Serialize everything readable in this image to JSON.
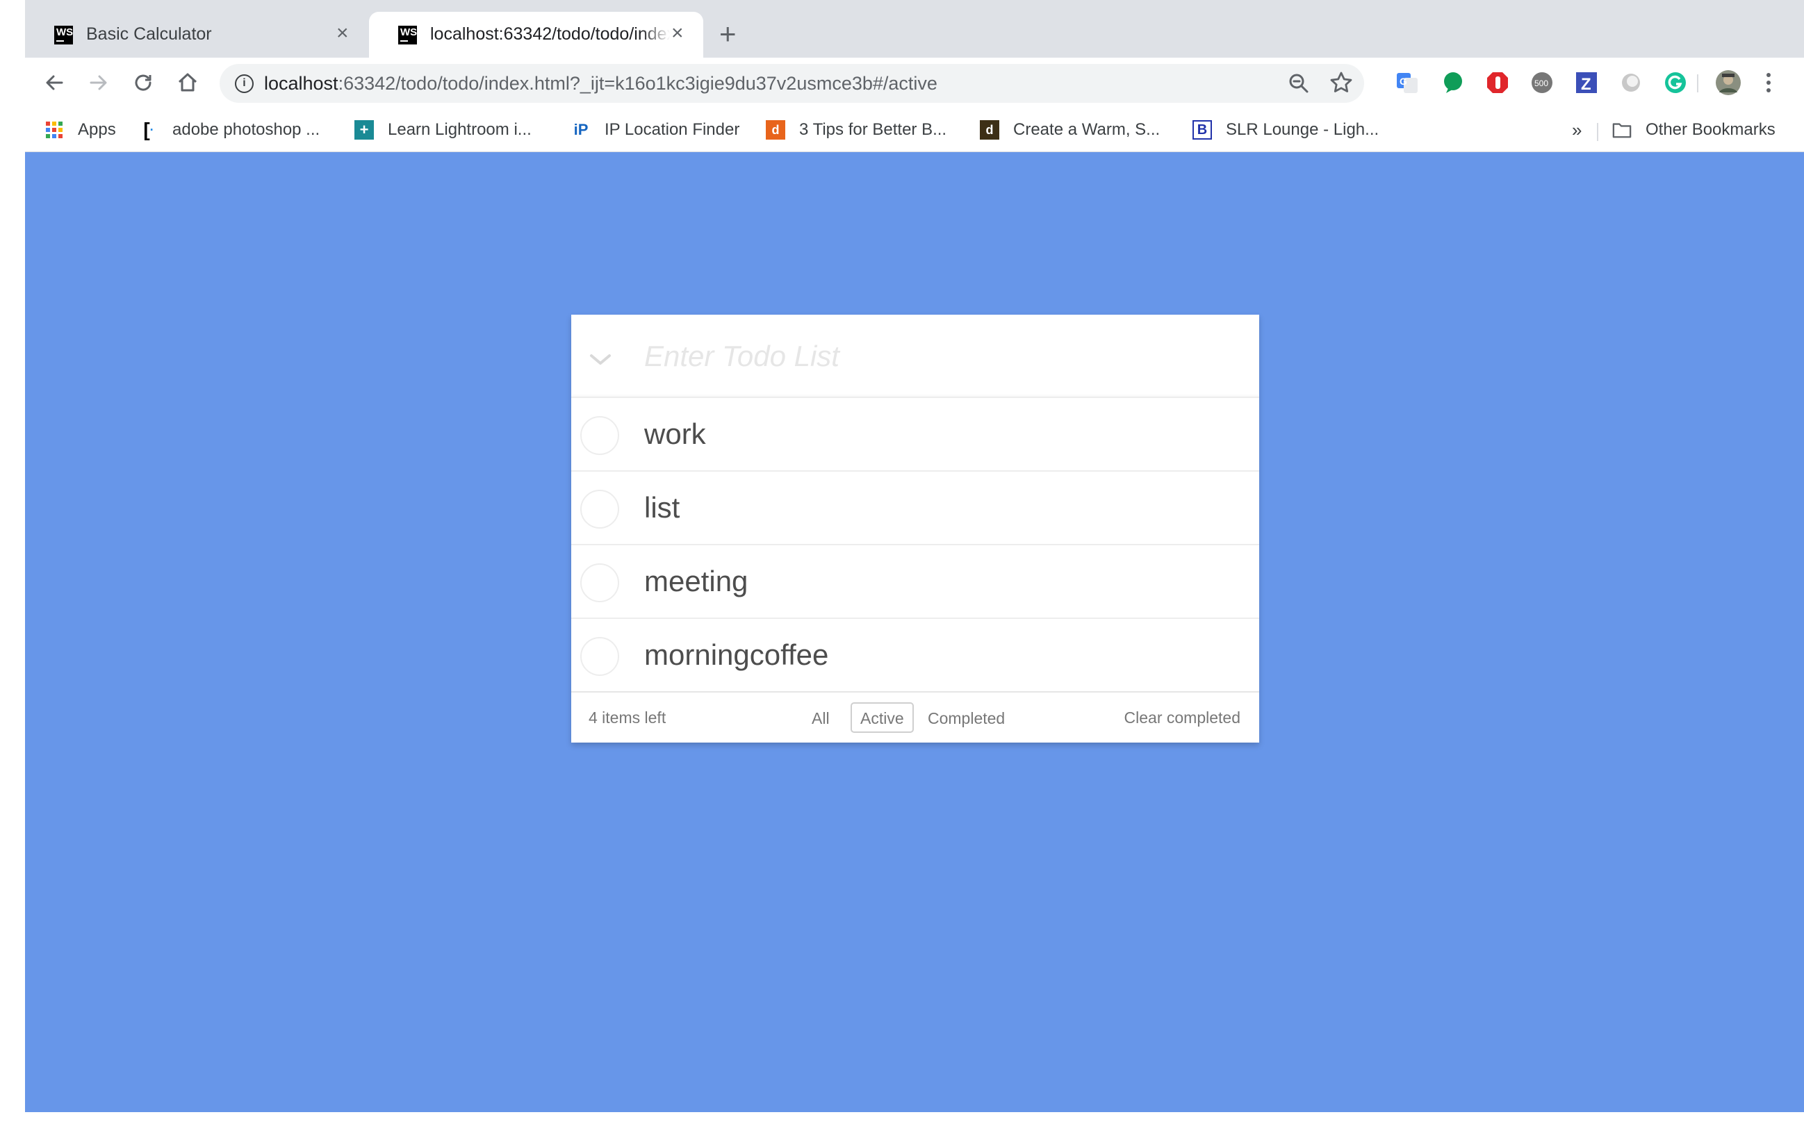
{
  "browser": {
    "tabs": [
      {
        "title": "Basic Calculator",
        "favicon": "WS"
      },
      {
        "title": "localhost:63342/todo/todo/index.html",
        "favicon": "WS"
      }
    ],
    "url_host": "localhost",
    "url_rest": ":63342/todo/todo/index.html?_ijt=k16o1kc3igie9du37v2usmce3b#/active",
    "bookmarks": [
      {
        "label": "Apps",
        "icon": "apps-grid-icon"
      },
      {
        "label": "adobe photoshop ...",
        "icon": "bracket-icon"
      },
      {
        "label": "Learn Lightroom i...",
        "icon": "plus-cross-icon"
      },
      {
        "label": "IP Location Finder",
        "icon": "ip-icon"
      },
      {
        "label": "3 Tips for Better B...",
        "icon": "dr-icon"
      },
      {
        "label": "Create a Warm, S...",
        "icon": "ds-icon"
      },
      {
        "label": "SLR Lounge - Ligh...",
        "icon": "b-icon"
      }
    ],
    "bookmarks_overflow": "»",
    "other_bookmarks": "Other Bookmarks"
  },
  "todo": {
    "placeholder": "Enter Todo List",
    "items": [
      {
        "label": "work",
        "completed": false
      },
      {
        "label": "list",
        "completed": false
      },
      {
        "label": "meeting",
        "completed": false
      },
      {
        "label": "morningcoffee",
        "completed": false
      }
    ],
    "footer": {
      "count_text": "4 items left",
      "filters": [
        "All",
        "Active",
        "Completed"
      ],
      "selected_filter": "Active",
      "clear_label": "Clear completed"
    }
  },
  "colors": {
    "page_background": "#6796e9",
    "tabstrip": "#dee1e6"
  }
}
